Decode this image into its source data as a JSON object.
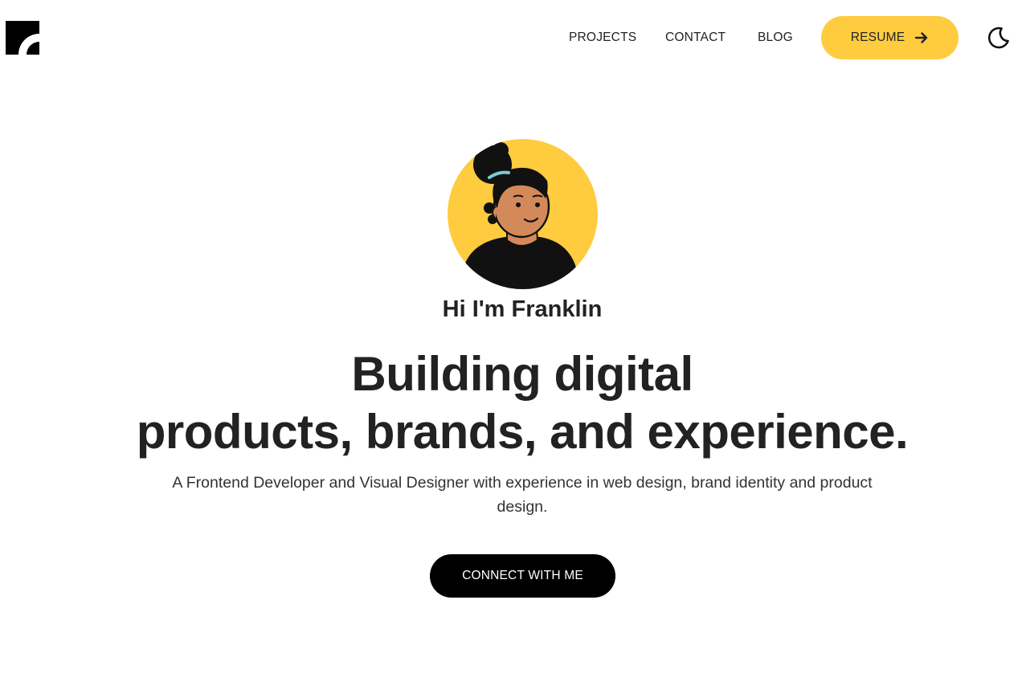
{
  "header": {
    "logo_icon": "brand-logo-icon",
    "nav": {
      "projects": "PROJECTS",
      "contact": "CONTACT",
      "blog": "BLOG"
    },
    "resume_label": "RESUME",
    "resume_icon": "arrow-right-icon",
    "theme_icon": "moon-icon"
  },
  "hero": {
    "greeting": "Hi I'm Franklin",
    "headline_line1": "Building digital",
    "headline_line2": "products, brands, and experience.",
    "subtitle": "A Frontend Developer and Visual Designer with experience in web design, brand identity and product design.",
    "cta_label": "CONNECT WITH ME"
  },
  "colors": {
    "accent": "#ffcb3f",
    "text": "#222222",
    "cta_bg": "#000000",
    "skin": "#d4895a"
  }
}
